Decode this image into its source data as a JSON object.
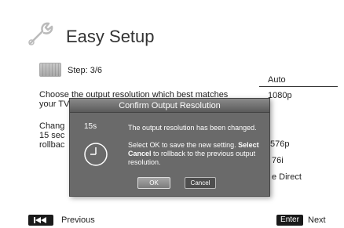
{
  "header": {
    "title": "Easy Setup",
    "icon": "wrench-icon"
  },
  "step": {
    "label": "Step: 3/6"
  },
  "description": {
    "line1": "Choose the output resolution which best matches",
    "line2": "your TV.",
    "line3": "Chang",
    "line4": "15 sec",
    "line5": "rollbac"
  },
  "options": {
    "items": [
      "Auto",
      "1080p",
      "576p",
      "76i",
      "e Direct"
    ]
  },
  "dialog": {
    "title": "Confirm Output Resolution",
    "timer": "15s",
    "message1": "The output resolution has been changed.",
    "message2_part1": "Select OK to save the new setting.",
    "message2_bold1": "Select Cancel",
    "message2_part2": "to rollback to the previous output resolution.",
    "ok_label": "OK",
    "cancel_label": "Cancel"
  },
  "footer": {
    "prev_label": "Previous",
    "enter_label": "Enter",
    "next_label": "Next"
  },
  "colors": {
    "dialog_bg": "#6a6a6a",
    "header_bg": "#5b5b5b",
    "button_dark": "#1a1a1a"
  }
}
